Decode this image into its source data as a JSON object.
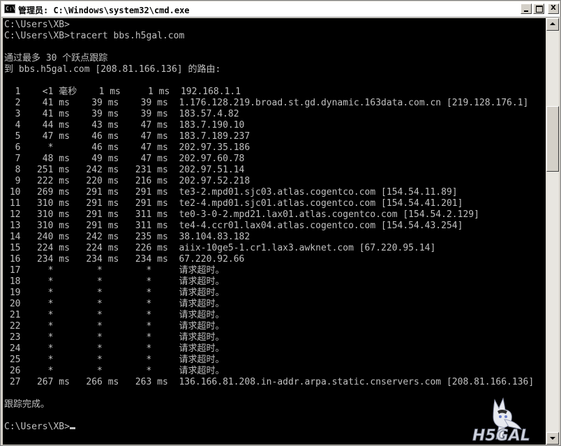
{
  "window": {
    "title": "管理员: C:\\Windows\\system32\\cmd.exe",
    "icon": "cmd-icon",
    "icon_text": "C:\\",
    "buttons": {
      "minimize": "minimize-icon",
      "maximize": "maximize-icon",
      "close_label": "X"
    }
  },
  "console": {
    "lines": [
      "C:\\Users\\XB>",
      "C:\\Users\\XB>tracert bbs.h5gal.com",
      "",
      "通过最多 30 个跃点跟踪",
      "到 bbs.h5gal.com [208.81.166.136] 的路由:",
      "",
      "  1    <1 毫秒    1 ms     1 ms  192.168.1.1",
      "  2    41 ms    39 ms    39 ms  1.176.128.219.broad.st.gd.dynamic.163data.com.cn [219.128.176.1]",
      "  3    41 ms    39 ms    39 ms  183.57.4.82",
      "  4    44 ms    43 ms    47 ms  183.7.190.10",
      "  5    47 ms    46 ms    47 ms  183.7.189.237",
      "  6     *       46 ms    47 ms  202.97.35.186",
      "  7    48 ms    49 ms    47 ms  202.97.60.78",
      "  8   251 ms   242 ms   231 ms  202.97.51.14",
      "  9   222 ms   220 ms   216 ms  202.97.52.218",
      " 10   269 ms   291 ms   291 ms  te3-2.mpd01.sjc03.atlas.cogentco.com [154.54.11.89]",
      " 11   310 ms   291 ms   291 ms  te2-4.mpd01.sjc01.atlas.cogentco.com [154.54.41.201]",
      " 12   310 ms   291 ms   311 ms  te0-3-0-2.mpd21.lax01.atlas.cogentco.com [154.54.2.129]",
      " 13   310 ms   291 ms   311 ms  te4-4.ccr01.lax04.atlas.cogentco.com [154.54.43.254]",
      " 14   240 ms   242 ms   235 ms  38.104.83.182",
      " 15   224 ms   224 ms   226 ms  aiix-10ge5-1.cr1.lax3.awknet.com [67.220.95.14]",
      " 16   234 ms   234 ms   234 ms  67.220.92.66",
      " 17     *        *        *     请求超时。",
      " 18     *        *        *     请求超时。",
      " 19     *        *        *     请求超时。",
      " 20     *        *        *     请求超时。",
      " 21     *        *        *     请求超时。",
      " 22     *        *        *     请求超时。",
      " 23     *        *        *     请求超时。",
      " 24     *        *        *     请求超时。",
      " 25     *        *        *     请求超时。",
      " 26     *        *        *     请求超时。",
      " 27   267 ms   266 ms   263 ms  136.166.81.208.in-addr.arpa.static.cnservers.com [208.81.166.136]",
      "",
      "跟踪完成。",
      "",
      "C:\\Users\\XB>"
    ]
  },
  "watermark": {
    "text": "H5GAL"
  },
  "colors": {
    "console_bg": "#000000",
    "console_fg": "#c0c0c0",
    "chrome": "#d4d0c8"
  }
}
